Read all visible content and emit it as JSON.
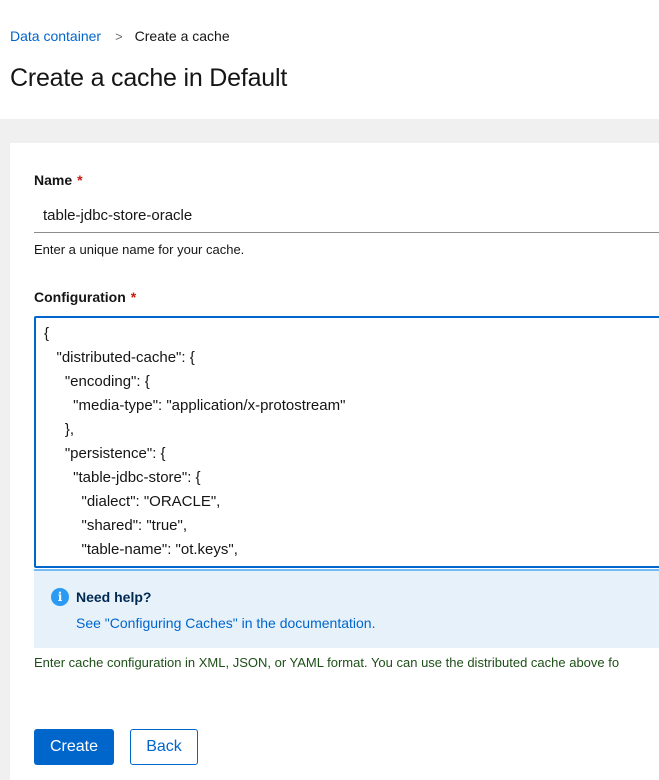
{
  "breadcrumb": {
    "parent": "Data container",
    "separator": ">",
    "current": "Create a cache"
  },
  "page_title": "Create a cache in Default",
  "form": {
    "name": {
      "label": "Name",
      "required_mark": "*",
      "value": "table-jdbc-store-oracle",
      "helper": "Enter a unique name for your cache."
    },
    "configuration": {
      "label": "Configuration",
      "required_mark": "*",
      "lines": [
        "{",
        "   \"distributed-cache\": {",
        "     \"encoding\": {",
        "       \"media-type\": \"application/x-protostream\"",
        "     },",
        "     \"persistence\": {",
        "       \"table-jdbc-store\": {",
        "         \"dialect\": \"ORACLE\",",
        "         \"shared\": \"true\",",
        "         \"table-name\": \"ot.keys\","
      ],
      "helper": "Enter cache configuration in XML, JSON, or YAML format. You can use the distributed cache above fo"
    }
  },
  "alert": {
    "icon": "info-icon",
    "icon_glyph": "i",
    "title": "Need help?",
    "link": "See \"Configuring Caches\" in the documentation."
  },
  "actions": {
    "create_label": "Create",
    "back_label": "Back"
  },
  "colors": {
    "primary": "#0066cc",
    "required": "#c9190b",
    "alert_bg": "#e7f1fa",
    "helper_success": "#1e4f18"
  }
}
